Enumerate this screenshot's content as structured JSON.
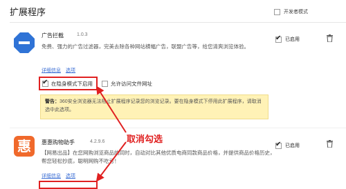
{
  "header": {
    "title": "扩展程序",
    "dev_mode_label": "开发者模式"
  },
  "extensions": [
    {
      "name": "广告拦截",
      "version": "1.0.3",
      "description": "免费、强力的广告过滤器，完美去除各种网站横幅广告，联盟广告等，给您清爽浏览体验。",
      "links": [
        "详细信息",
        "选项"
      ],
      "options": [
        {
          "label": "在隐身模式下启用",
          "checked": true
        },
        {
          "label": "允许访问文件网址",
          "checked": false
        }
      ],
      "warning_prefix": "警告：",
      "warning_text": "360安全浏览器无法阻止扩展程序记录您的浏览记录。要在隐身模式下停用此扩展程序，请取消选中此选项。",
      "enabled_label": "已启用",
      "enabled": true,
      "icon": "minus-octagon-icon",
      "icon_color": "#2f73d6"
    },
    {
      "name": "惠惠购物助手",
      "version": "4.2.9.6",
      "description": "【网易出品】在您网购浏览商品的同时，自动对比其他优质电商同款商品价格，并提供商品价格历史，帮您轻松抄底，聪明网购不吃亏！",
      "links": [
        "详细信息",
        "选项"
      ],
      "icon_glyph": "惠",
      "enabled_label": "已启用",
      "enabled": true,
      "icon_color": "#f0692b"
    }
  ],
  "annotation": {
    "text": "取消勾选",
    "color": "#e02020"
  }
}
